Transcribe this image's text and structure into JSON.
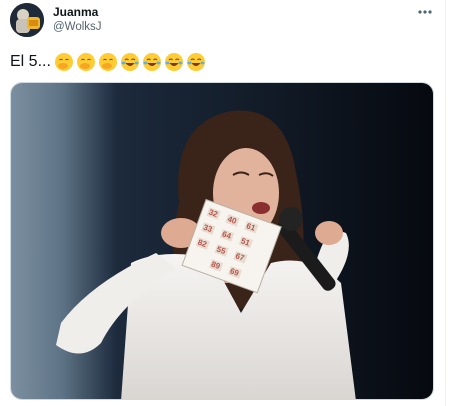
{
  "tweet": {
    "display_name": "Juanma",
    "handle": "@WolksJ",
    "text": "El 5...",
    "emojis": [
      "face-with-hand-over-mouth",
      "face-with-hand-over-mouth",
      "face-with-hand-over-mouth",
      "face-with-tears-of-joy",
      "face-with-tears-of-joy",
      "face-with-tears-of-joy",
      "face-with-tears-of-joy"
    ],
    "more_icon": "more-horizontal-icon",
    "media_alt": "Photo of a woman speaking into a microphone holding a bingo card"
  },
  "bingo_card": {
    "numbers": [
      "32",
      "40",
      "61",
      "33",
      "64",
      "51",
      "82",
      "55",
      "67",
      "89",
      "69"
    ]
  },
  "colors": {
    "text_primary": "#0f1419",
    "text_secondary": "#536471",
    "divider": "#eff3f4"
  }
}
